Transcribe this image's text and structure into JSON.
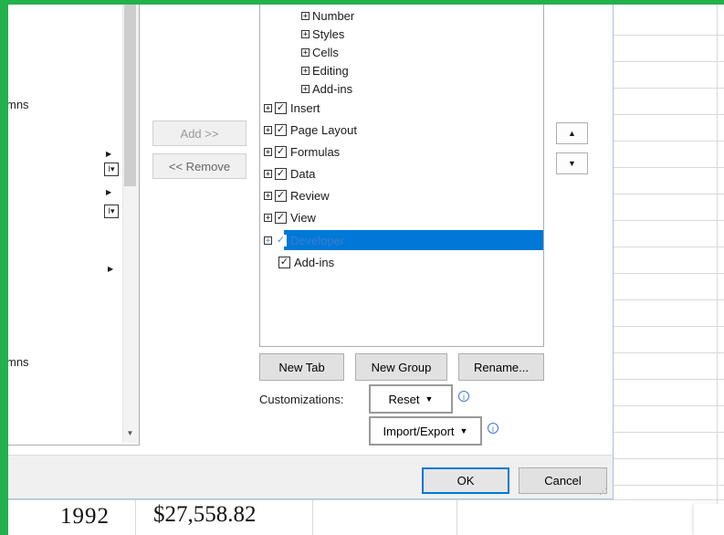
{
  "left_list": {
    "partial_label_1": "mns",
    "partial_label_2": "mns"
  },
  "middle_buttons": {
    "add": "Add >>",
    "remove": "<< Remove"
  },
  "tree": {
    "subgroups": [
      "Number",
      "Styles",
      "Cells",
      "Editing",
      "Add-ins"
    ],
    "tabs": [
      {
        "label": "Insert",
        "checked": true,
        "expand": true,
        "selected": false
      },
      {
        "label": "Page Layout",
        "checked": true,
        "expand": true,
        "selected": false
      },
      {
        "label": "Formulas",
        "checked": true,
        "expand": true,
        "selected": false
      },
      {
        "label": "Data",
        "checked": true,
        "expand": true,
        "selected": false
      },
      {
        "label": "Review",
        "checked": true,
        "expand": true,
        "selected": false
      },
      {
        "label": "View",
        "checked": true,
        "expand": true,
        "selected": false
      },
      {
        "label": "Developer",
        "checked": true,
        "expand": true,
        "selected": true
      },
      {
        "label": "Add-ins",
        "checked": true,
        "expand": false,
        "selected": false
      }
    ]
  },
  "tab_buttons": {
    "new_tab": "New Tab",
    "new_group": "New Group",
    "rename": "Rename..."
  },
  "customizations": {
    "label": "Customizations:",
    "reset": "Reset",
    "import_export": "Import/Export"
  },
  "footer": {
    "ok": "OK",
    "cancel": "Cancel"
  },
  "sheet": {
    "year": "1992",
    "amount": "$27,558.82"
  },
  "colors": {
    "accent": "#0078d7",
    "frame": "#22b14c"
  }
}
